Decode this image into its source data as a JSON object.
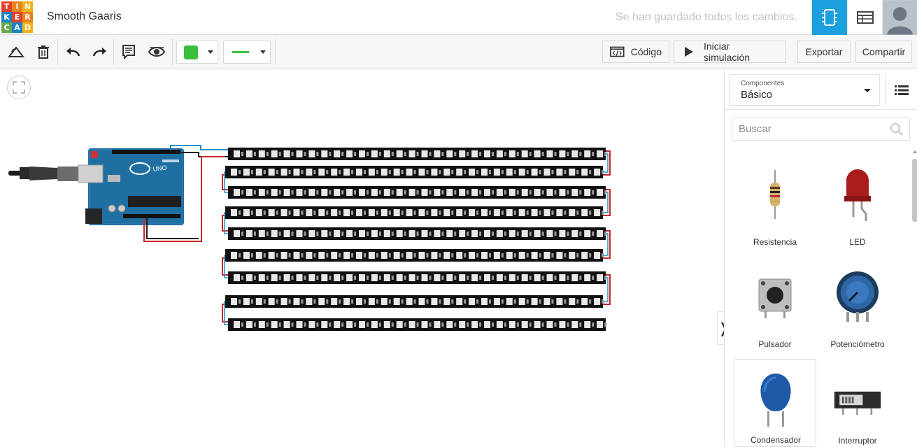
{
  "header": {
    "logo_letters": [
      "T",
      "I",
      "N",
      "K",
      "E",
      "R",
      "C",
      "A",
      "D"
    ],
    "logo_colors": [
      "#e2402b",
      "#e7821e",
      "#f2b314",
      "#1a83c6",
      "#e2402b",
      "#e7821e",
      "#6aa84f",
      "#1a83c6",
      "#f2b314"
    ],
    "project_title": "Smooth Gaaris",
    "save_status": "Se han guardado todos los cambios.",
    "accent": "#1aa0dc"
  },
  "toolbar": {
    "code_label": "Código",
    "simulate_label": "Iniciar simulación",
    "export_label": "Exportar",
    "share_label": "Compartir",
    "fill_color": "#3cbf3c",
    "wire_color": "#3cbf3c"
  },
  "canvas": {
    "led_strip_count": 9
  },
  "panel": {
    "category_caption": "Componentes",
    "category_value": "Básico",
    "search_placeholder": "Buscar",
    "components": [
      {
        "label": "Resistencia",
        "icon": "resistor-icon"
      },
      {
        "label": "LED",
        "icon": "led-icon"
      },
      {
        "label": "Pulsador",
        "icon": "pushbutton-icon"
      },
      {
        "label": "Potenciómetro",
        "icon": "potentiometer-icon"
      },
      {
        "label": "Condensador",
        "icon": "capacitor-icon"
      },
      {
        "label": "Interruptor",
        "icon": "switch-icon"
      }
    ]
  }
}
